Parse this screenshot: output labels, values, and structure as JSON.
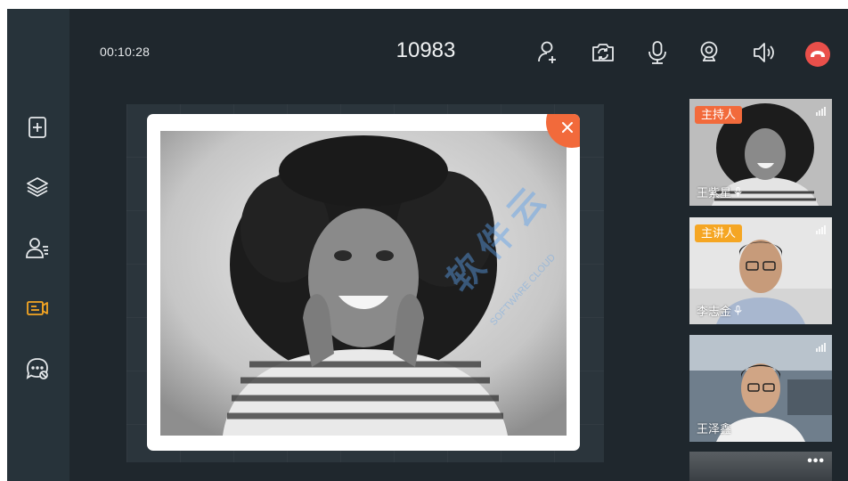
{
  "call": {
    "timer": "00:10:28",
    "room_id": "10983"
  },
  "toolbar": {
    "icons": [
      "add-user-icon",
      "switch-camera-icon",
      "microphone-icon",
      "webcam-icon",
      "speaker-icon",
      "hang-up-icon"
    ]
  },
  "sidebar": {
    "icons": [
      "add-document-icon",
      "layers-icon",
      "participants-list-icon",
      "screen-share-icon",
      "mute-chat-icon"
    ],
    "active_color": "#f5a623"
  },
  "watermark": {
    "text": "软件云",
    "sub": "SOFTWARE CLOUD"
  },
  "participants": [
    {
      "role": "主持人",
      "name": "王紫星",
      "role_color": "#f26a3b"
    },
    {
      "role": "主讲人",
      "name": "李志金",
      "role_color": "#f5a623"
    },
    {
      "role": "",
      "name": "王泽鑫",
      "role_color": ""
    }
  ],
  "more_label": "•••",
  "colors": {
    "accent": "#f26a3b",
    "hangup": "#e94f4a",
    "background": "#1f272d",
    "sidebar": "#27333a"
  }
}
